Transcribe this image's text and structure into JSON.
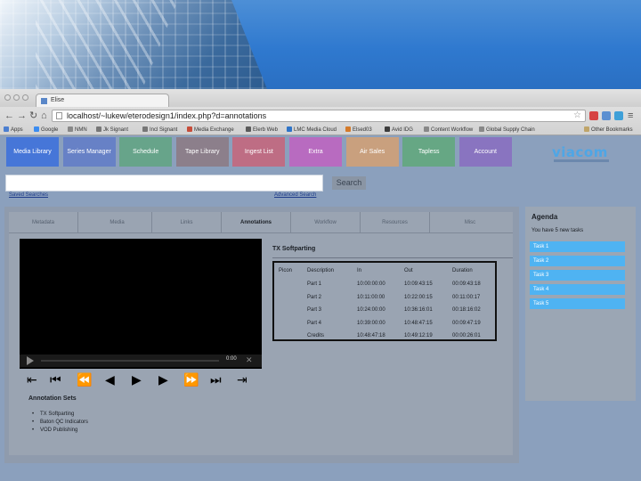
{
  "browser": {
    "tab_title": "Elise",
    "url": "localhost/~lukew/eterodesign1/index.php?d=annotations",
    "bookmarks": [
      "Apps",
      "Google",
      "NMN",
      "Jk Signant",
      "Incl Signant",
      "Media Exchange",
      "Elerb Web",
      "LMC Media Cloud",
      "Elsed03",
      "Avid IDG",
      "Content Workflow",
      "Global Supply Chain",
      "Other Bookmarks"
    ]
  },
  "nav_tabs": [
    {
      "label": "Media Library",
      "color": "#4676d8"
    },
    {
      "label": "Series Manager",
      "color": "#6781c6"
    },
    {
      "label": "Schedule",
      "color": "#67a48a"
    },
    {
      "label": "Tape Library",
      "color": "#8c7f8b"
    },
    {
      "label": "Ingest List",
      "color": "#be6d84"
    },
    {
      "label": "Extra",
      "color": "#b86bc0"
    },
    {
      "label": "Air Sales",
      "color": "#c9a07e"
    },
    {
      "label": "Tapless",
      "color": "#66a784"
    },
    {
      "label": "Account",
      "color": "#8974c0"
    }
  ],
  "logo": "viacom",
  "search": {
    "placeholder": "",
    "button_label": "Search",
    "saved_searches": "Saved Searches",
    "advanced_search": "Advanced Search"
  },
  "subtabs": [
    "Metadata",
    "Media",
    "Links",
    "Annotations",
    "Workflow",
    "Resources",
    "Misc"
  ],
  "active_subtab": "Annotations",
  "player": {
    "time": "0:00"
  },
  "annotation_sets": {
    "title": "Annotation Sets",
    "items": [
      "TX Softparting",
      "Baton QC Indicators",
      "VOD Publishing"
    ]
  },
  "segments": {
    "title": "TX Softparting",
    "headers": [
      "Picon",
      "Description",
      "In",
      "Out",
      "Duration"
    ],
    "rows": [
      [
        "",
        "Part 1",
        "10:00:00:00",
        "10:09:43:15",
        "00:09:43:18"
      ],
      [
        "",
        "Part 2",
        "10:11:00:00",
        "10:22:00:15",
        "00:11:00:17"
      ],
      [
        "",
        "Part 3",
        "10:24:00:00",
        "10:36:16:01",
        "00:18:16:02"
      ],
      [
        "",
        "Part 4",
        "10:39:00:00",
        "10:48:47:15",
        "00:09:47:19"
      ],
      [
        "",
        "Credits",
        "10:48:47:18",
        "10:49:12:19",
        "00:00:26:01"
      ]
    ]
  },
  "agenda": {
    "title": "Agenda",
    "subtitle": "You have 5 new tasks",
    "tasks": [
      "Task 1",
      "Task 2",
      "Task 3",
      "Task 4",
      "Task 5"
    ]
  }
}
